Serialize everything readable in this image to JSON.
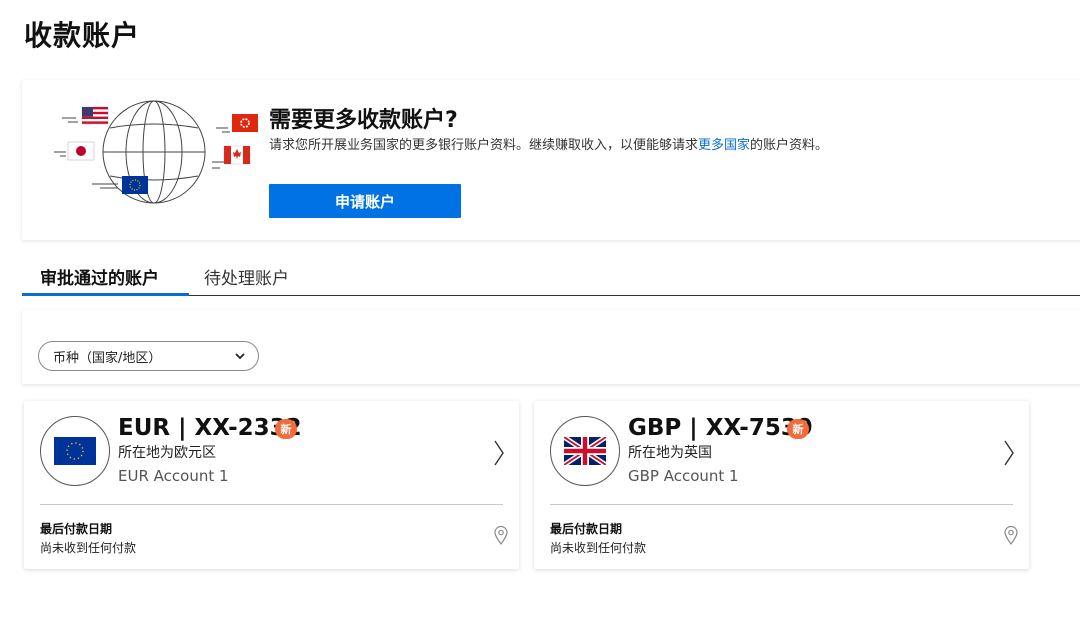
{
  "page": {
    "title": "收款账户"
  },
  "promo": {
    "title": "需要更多收款账户?",
    "desc_before": "请求您所开展业务国家的更多银行账户资料。继续赚取收入，以便能够请求",
    "desc_link": "更多国家",
    "desc_after": "的账户资料。",
    "button_label": "申请账户",
    "flags": [
      "us-flag-icon",
      "hk-flag-icon",
      "jp-flag-icon",
      "ca-flag-icon",
      "eu-flag-icon"
    ]
  },
  "tabs": [
    {
      "label": "审批通过的账户",
      "active": true
    },
    {
      "label": "待处理账户",
      "active": false
    }
  ],
  "filter": {
    "selected": "币种（国家/地区）"
  },
  "accounts": [
    {
      "currency": "EUR",
      "number": "XX-2332",
      "badge": "新",
      "location": "所在地为欧元区",
      "name": "EUR Account 1",
      "last_payment_label": "最后付款日期",
      "last_payment_value": "尚未收到任何付款",
      "flag": "eu-flag-icon"
    },
    {
      "currency": "GBP",
      "number": "XX-7539",
      "badge": "新",
      "location": "所在地为英国",
      "name": "GBP Account 1",
      "last_payment_label": "最后付款日期",
      "last_payment_value": "尚未收到任何付款",
      "flag": "uk-flag-icon"
    }
  ],
  "colors": {
    "accent": "#0072e3",
    "link": "#0a6ed1",
    "badge": "#f26b3a",
    "eu_blue": "#003399",
    "eu_star": "#ffcc00"
  }
}
